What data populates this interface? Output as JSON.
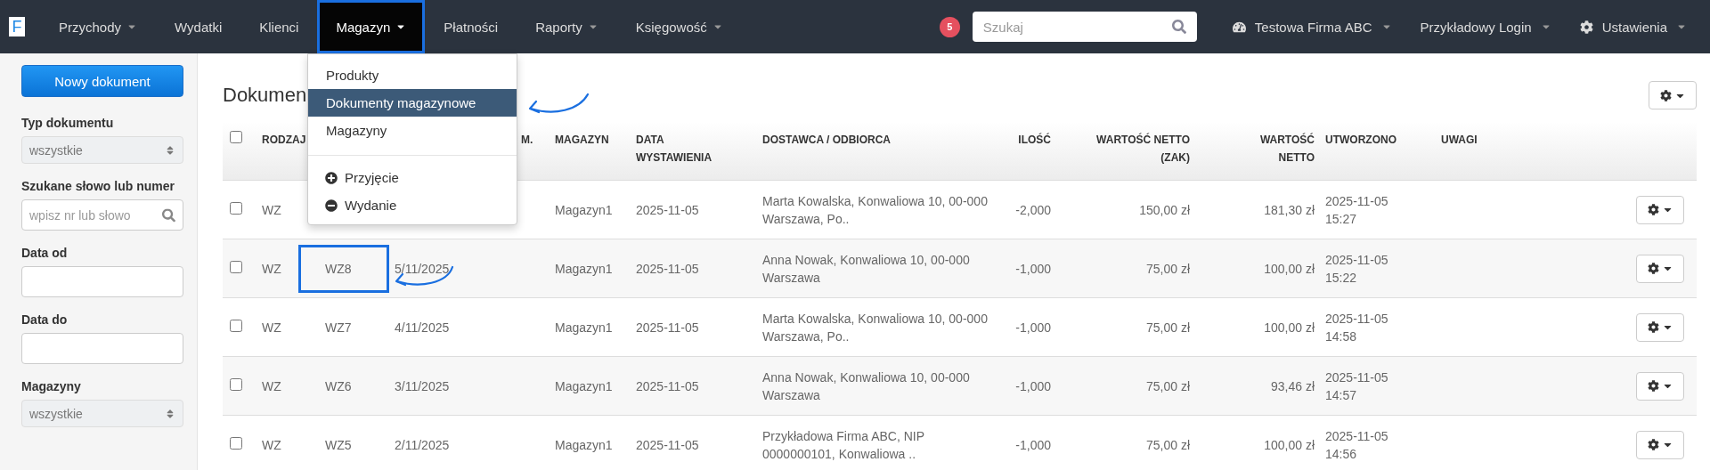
{
  "nav": {
    "logo": "F",
    "items": [
      {
        "label": "Przychody",
        "has_menu": true,
        "selected": false,
        "outlined": false
      },
      {
        "label": "Wydatki",
        "has_menu": false,
        "selected": false,
        "outlined": false
      },
      {
        "label": "Klienci",
        "has_menu": false,
        "selected": false,
        "outlined": false
      },
      {
        "label": "Magazyn",
        "has_menu": true,
        "selected": true,
        "outlined": true
      },
      {
        "label": "Płatności",
        "has_menu": false,
        "selected": false,
        "outlined": false
      },
      {
        "label": "Raporty",
        "has_menu": true,
        "selected": false,
        "outlined": false
      },
      {
        "label": "Księgowość",
        "has_menu": true,
        "selected": false,
        "outlined": false
      }
    ],
    "badge": "5",
    "search": {
      "placeholder": "Szukaj"
    },
    "right_items": [
      {
        "kind": "company",
        "label": "Testowa Firma ABC"
      },
      {
        "kind": "user",
        "label": "Przykładowy Login"
      },
      {
        "kind": "settings",
        "label": "Ustawienia"
      }
    ]
  },
  "dropdown": {
    "sections": [
      [
        {
          "kind": "link",
          "label": "Produkty",
          "selected": false
        },
        {
          "kind": "link",
          "label": "Dokumenty magazynowe",
          "selected": true
        },
        {
          "kind": "link",
          "label": "Magazyny",
          "selected": false
        }
      ],
      [
        {
          "kind": "add",
          "label": "Przyjęcie",
          "selected": false
        },
        {
          "kind": "remove",
          "label": "Wydanie",
          "selected": false
        }
      ]
    ]
  },
  "sidebar": {
    "new_button": "Nowy dokument",
    "filters": [
      {
        "kind": "select",
        "label": "Typ dokumentu",
        "value": "wszystkie"
      },
      {
        "kind": "search",
        "label": "Szukane słowo lub numer",
        "placeholder": "wpisz nr lub słowo"
      },
      {
        "kind": "input",
        "label": "Data od"
      },
      {
        "kind": "input",
        "label": "Data do"
      },
      {
        "kind": "select",
        "label": "Magazyny",
        "value": "wszystkie"
      }
    ]
  },
  "page": {
    "title": "Dokumen"
  },
  "table": {
    "select_all_checked": false,
    "header": {
      "type": "RODZAJ",
      "column_3": "M.",
      "warehouse": "MAGAZYN",
      "issue_date": "DATA\nWYSTAWIENIA",
      "party": "DOSTAWCA / ODBIORCA",
      "qty": "ILOŚĆ",
      "net_purchase": "WARTOŚĆ NETTO\n(ZAK)",
      "net": "WARTOŚĆ\nNETTO",
      "created": "UTWORZONO",
      "notes": "UWAGI"
    },
    "rows": [
      {
        "checked": false,
        "type": "WZ",
        "warehouse": "Magazyn1",
        "issue_date": "2025-11-05",
        "party": "Marta Kowalska, Konwaliowa 10, 00-000 Warszawa, Po..",
        "qty": "-2,000",
        "net_purchase": "150,00 zł",
        "net": "181,30 zł",
        "created": "2025-11-05\n15:27"
      },
      {
        "checked": false,
        "type": "WZ",
        "number": "WZ8",
        "doc_date": "5/11/2025",
        "warehouse": "Magazyn1",
        "issue_date": "2025-11-05",
        "party": "Anna Nowak, Konwaliowa 10, 00-000 Warszawa",
        "qty": "-1,000",
        "net_purchase": "75,00 zł",
        "net": "100,00 zł",
        "created": "2025-11-05\n15:22",
        "outlined": true
      },
      {
        "checked": false,
        "type": "WZ",
        "number": "WZ7",
        "doc_date": "4/11/2025",
        "warehouse": "Magazyn1",
        "issue_date": "2025-11-05",
        "party": "Marta Kowalska, Konwaliowa 10, 00-000 Warszawa, Po..",
        "qty": "-1,000",
        "net_purchase": "75,00 zł",
        "net": "100,00 zł",
        "created": "2025-11-05\n14:58",
        "outlined": false
      },
      {
        "checked": false,
        "type": "WZ",
        "number": "WZ6",
        "doc_date": "3/11/2025",
        "warehouse": "Magazyn1",
        "issue_date": "2025-11-05",
        "party": "Anna Nowak, Konwaliowa 10, 00-000 Warszawa",
        "qty": "-1,000",
        "net_purchase": "75,00 zł",
        "net": "93,46 zł",
        "created": "2025-11-05\n14:57",
        "outlined": false
      },
      {
        "checked": false,
        "type": "WZ",
        "number": "WZ5",
        "doc_date": "2/11/2025",
        "warehouse": "Magazyn1",
        "issue_date": "2025-11-05",
        "party": "Przykładowa Firma ABC, NIP 0000000101, Konwaliowa ..",
        "qty": "-1,000",
        "net_purchase": "75,00 zł",
        "net": "100,00 zł",
        "created": "2025-11-05\n14:56",
        "outlined": false
      }
    ]
  }
}
